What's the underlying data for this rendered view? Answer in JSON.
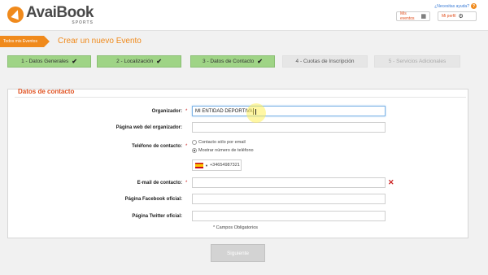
{
  "header": {
    "logo": {
      "name": "AvaiBook",
      "sub": "SPORTS"
    },
    "help_link": "¿Necesitas ayuda?",
    "help_icon": "question-icon",
    "my_events": "Mis eventos",
    "my_events_icon": "calendar-icon",
    "my_profile": "Mi perfil",
    "my_profile_icon": "gear-icon"
  },
  "breadcrumb": "Todos mis Eventos",
  "page_title": "Crear un nuevo Evento",
  "steps": [
    {
      "label": "1 - Datos Generales",
      "state": "done"
    },
    {
      "label": "2 - Localización",
      "state": "done"
    },
    {
      "label": "3 - Datos de Contacto",
      "state": "done"
    },
    {
      "label": "4 - Cuotas de Inscripción",
      "state": "pending"
    },
    {
      "label": "5 - Servicios Adicionales",
      "state": "disabled"
    }
  ],
  "section_title": "Datos de contacto",
  "form": {
    "organizer_label": "Organizador:",
    "organizer_value": "MI ENTIDAD DEPORTIVA",
    "website_label": "Página web del organizador:",
    "website_value": "",
    "phone_label": "Teléfono de contacto:",
    "phone_option_email": "Contacto sólo por email",
    "phone_option_show": "Mostrar número de teléfono",
    "phone_option_selected": "Mostrar número de teléfono",
    "phone_value": "+34654987321",
    "email_label": "E-mail de contacto:",
    "email_value": "",
    "facebook_label": "Página Facebook oficial:",
    "facebook_value": "",
    "twitter_label": "Página Twitter oficial:",
    "twitter_value": "",
    "required_mark": "*",
    "required_note": "* Campos Obligatorios"
  },
  "next_button": "Siguiente",
  "colors": {
    "brand_orange": "#f08a1c",
    "step_done": "#9fd486",
    "error_red": "#cc2222"
  }
}
